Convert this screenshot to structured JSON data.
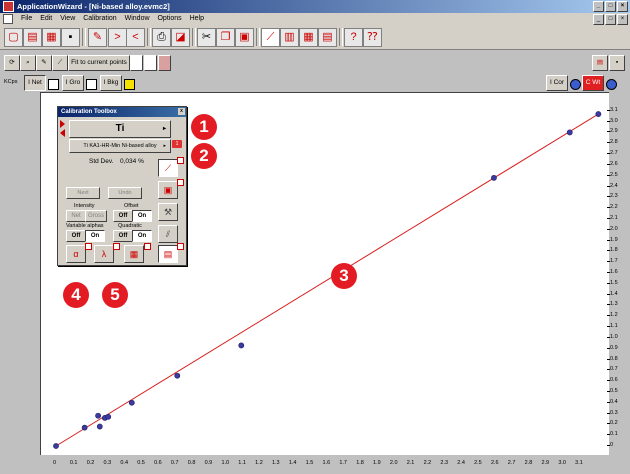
{
  "window": {
    "title": "ApplicationWizard - [Ni-based alloy.evmc2]",
    "controls": [
      "_",
      "□",
      "×"
    ],
    "mdi_controls": [
      "_",
      "□",
      "×"
    ]
  },
  "menu": [
    "File",
    "Edit",
    "View",
    "Calibration",
    "Window",
    "Options",
    "Help"
  ],
  "toolbar2": {
    "fit_label": "Fit to current points"
  },
  "toolbar3": {
    "kcps_label": "KCps",
    "inet_label": "I Net",
    "igro_label": "I Gro",
    "ibkg_label": "I Bkg",
    "icor_label": "I Cor",
    "cw_label": "C Wt"
  },
  "toolbox": {
    "title": "Calibration Toolbox",
    "close": "x",
    "element": "Ti",
    "element_arrow": "▸",
    "calibration": "Ti KA1-HR-Min Ni-based alloy",
    "calibration_arrow": "▸",
    "badge": "1",
    "std_dev_label": "Std Dev.",
    "std_dev_value": "0,034 %",
    "dim_btn1": "Next",
    "dim_btn2": "Undo",
    "intensity_label": "Intensity",
    "offset_label": "Offset",
    "net_label": "Net",
    "gross_label": "Gross",
    "offset_off": "Off",
    "offset_on": "On",
    "varalpha_label": "Variable alphas",
    "quadratic_label": "Quadratic",
    "varalpha_off": "Off",
    "varalpha_on": "On",
    "quad_off": "Off",
    "quad_on": "On"
  },
  "callouts": [
    "1",
    "2",
    "3",
    "4",
    "5"
  ],
  "chart_data": {
    "type": "scatter",
    "title": "",
    "xlabel": "",
    "ylabel": "",
    "xlim": [
      0,
      3.2
    ],
    "ylim": [
      0,
      3.2
    ],
    "x_ticks": [
      "0",
      "0.1",
      "0.2",
      "0.3",
      "0.4",
      "0.5",
      "0.6",
      "0.7",
      "0.8",
      "0.9",
      "1.0",
      "1.1",
      "1.2",
      "1.3",
      "1.4",
      "1.5",
      "1.6",
      "1.7",
      "1.8",
      "1.9",
      "2.0",
      "2.1",
      "2.2",
      "2.3",
      "2.4",
      "2.5",
      "2.6",
      "2.7",
      "2.8",
      "2.9",
      "3.0",
      "3.1"
    ],
    "y_ticks": [
      "0",
      "0.1",
      "0.2",
      "0.3",
      "0.4",
      "0.5",
      "0.6",
      "0.7",
      "0.8",
      "0.9",
      "1.0",
      "1.1",
      "1.2",
      "1.3",
      "1.4",
      "1.5",
      "1.6",
      "1.7",
      "1.8",
      "1.9",
      "2.0",
      "2.1",
      "2.2",
      "2.3",
      "2.4",
      "2.5",
      "2.6",
      "2.7",
      "2.8",
      "2.9",
      "3.0",
      "3.1"
    ],
    "points": [
      {
        "x": 0.0,
        "y": 0.0
      },
      {
        "x": 0.17,
        "y": 0.17
      },
      {
        "x": 0.25,
        "y": 0.28
      },
      {
        "x": 0.26,
        "y": 0.18
      },
      {
        "x": 0.29,
        "y": 0.26
      },
      {
        "x": 0.31,
        "y": 0.27
      },
      {
        "x": 0.45,
        "y": 0.4
      },
      {
        "x": 0.72,
        "y": 0.65
      },
      {
        "x": 1.1,
        "y": 0.93
      },
      {
        "x": 2.6,
        "y": 2.48
      },
      {
        "x": 3.05,
        "y": 2.9
      },
      {
        "x": 3.22,
        "y": 3.07
      }
    ],
    "fit_line": {
      "x": [
        0.0,
        3.22
      ],
      "y": [
        0.0,
        3.07
      ]
    },
    "point_color": "#3a3aa0",
    "line_color": "#d81e1e",
    "grid": false
  }
}
